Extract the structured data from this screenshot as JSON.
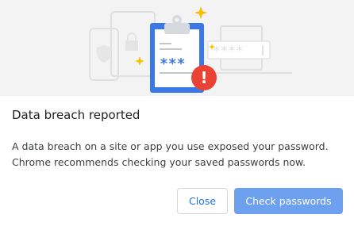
{
  "dialog": {
    "title": "Data breach reported",
    "body_line1": "A data breach on a site or app you use exposed your password.",
    "body_line2": "Chrome recommends checking your saved passwords now."
  },
  "illustration": {
    "clipboard_text": "***",
    "password_field_text": "****",
    "alert_symbol": "!",
    "colors": {
      "clipboard_blue": "#3b78e7",
      "alert_red": "#ea4335",
      "sparkle_yellow": "#fbbc04",
      "device_outline": "#e0e0e0",
      "banner_background": "#f3f3f3"
    }
  },
  "buttons": {
    "close_label": "Close",
    "check_label": "Check passwords"
  },
  "colors": {
    "accent": "#1a73e8",
    "primary_button": "#6ea0f0"
  }
}
